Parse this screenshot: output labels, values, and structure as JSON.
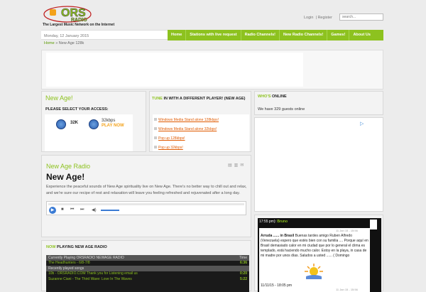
{
  "header": {
    "logo_text": "ORS",
    "logo_sub": "RADIO",
    "tagline": "The Largest Music Network on the Internet",
    "login": "Login",
    "register": "Register",
    "search_placeholder": "search...",
    "date": "Monday, 12 January 2015"
  },
  "nav": [
    "Home",
    "Stations with live request",
    "Radio Channels!",
    "New Radio Channels!",
    "Games!",
    "About Us"
  ],
  "breadcrumb": {
    "home": "Home",
    "current": "New Age 128k"
  },
  "access": {
    "title": "New Age!",
    "prompt": "PLEASE SELECT YOUR ACCESS:",
    "low": "32K",
    "high": "32kbps",
    "play": "PLAY NOW"
  },
  "tune": {
    "title_hl": "TUNE",
    "title_rest": " IN WITH A DIFFERENT PLAYER! (NEW AGE)",
    "links": [
      "Windows Media Stand alone 128kbps!",
      "Windows Media Stand alone 32kbps!",
      "Pop up 128kbps!",
      "Pop up 32kbps!"
    ]
  },
  "online": {
    "title_hl": "WHO'S",
    "title_rest": " ONLINE",
    "text": "We have 329 guests online"
  },
  "radio": {
    "section": "New Age Radio",
    "heading": "New Age!",
    "desc": "Experience the peaceful sounds of New Age spirituality live on New Age. There's no better way to chill out and relax, and we're sure our recipe of rest and relaxation will leave you feeling refreshed and rejuvenated after a long day."
  },
  "nowplaying": {
    "title_hl": "NOW",
    "title_rest": " PLAYING NEW AGE RADIO",
    "header": "Currently Playing ORSRADIO NEWAGE RADIO",
    "time_col": "Time",
    "rows": [
      {
        "t": "The Headhunters - 6/8-7/8",
        "d": "6:36",
        "hl": true
      },
      {
        "t": "Recently played songs",
        "d": "",
        "hl": false
      },
      {
        "t": "10b - ORSRADIO.COM Thank you for Listening email us",
        "d": "0:20",
        "hl": true
      },
      {
        "t": "Suzanne Ciani - The Third Wave: Love In The Waves",
        "d": "5:22",
        "hl": true
      }
    ]
  },
  "chat": {
    "time1": "17:55 pm",
    "name1": "Bruno",
    "date1": "11 Jan 15 - 15:56",
    "who": "Arruda ...... in",
    "country": "Brasil",
    "msg": "Buenas tardes amigo Ruben Alfredo (Venezuela) espero que estés bien con su familia .... Porque aquí en Brasil demasiado calor en mi ciudad que por lo general el clima es templado, está haciendo mucho calor. Estoy en la playa, in casa de mi madre por unos días. Saludos a usted ...... ( Domingo",
    "time2": "11/11/15 - 18:05 pm",
    "date2": "11 Jan 15 - 15:56"
  },
  "colors": {
    "accent": "#8dc21f",
    "link": "#e05a00"
  }
}
